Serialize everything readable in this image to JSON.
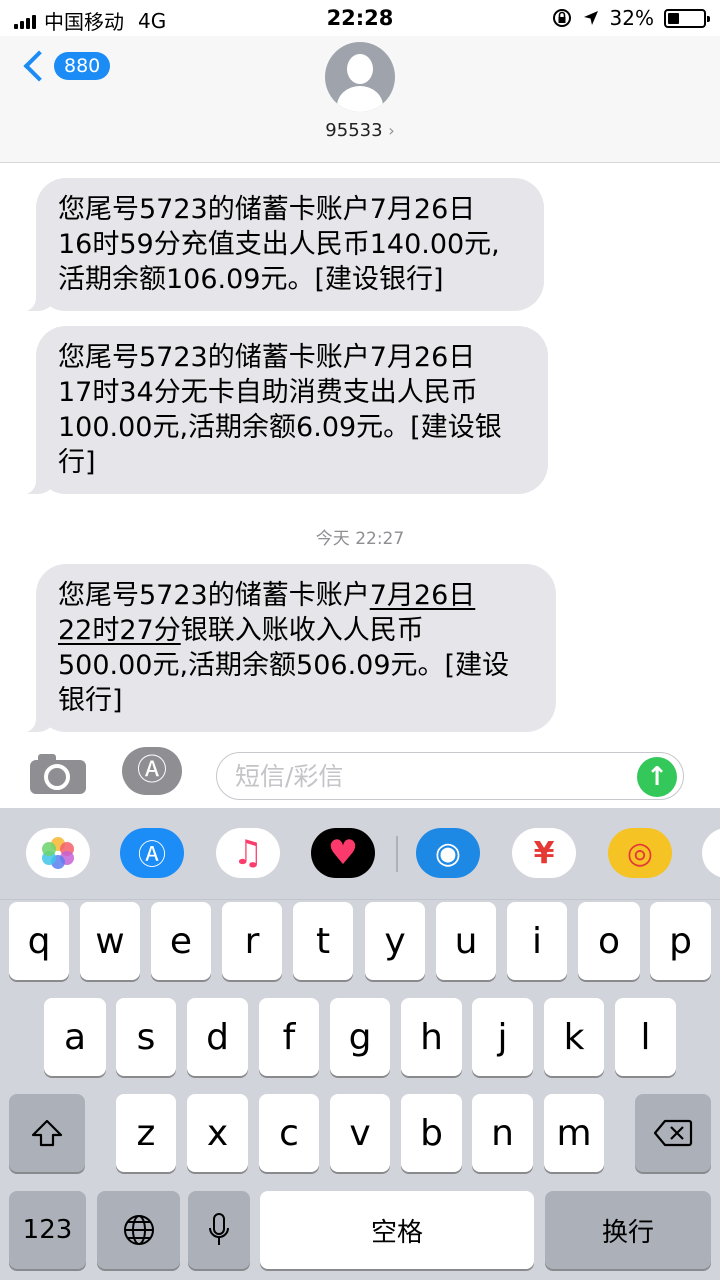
{
  "status_bar": {
    "carrier": "中国移动",
    "network": "4G",
    "time": "22:28",
    "battery_percent": "32%",
    "battery_level": 0.32,
    "icons": [
      "signal-icon",
      "orientation-lock-icon",
      "location-icon",
      "battery-icon"
    ]
  },
  "header": {
    "back_count": "880",
    "contact": "95533"
  },
  "messages": [
    {
      "text": "您尾号5723的储蓄卡账户7月26日16时59分充值支出人民币140.00元,活期余额106.09元。[建设银行]",
      "lines": [
        "您尾号5723的储蓄卡账户7月26日",
        "16时59分充值支出人民币140.00元,",
        "活期余额106.09元。[建设银行]"
      ]
    },
    {
      "text": "您尾号5723的储蓄卡账户7月26日17时34分无卡自助消费支出人民币100.00元,活期余额6.09元。[建设银行]",
      "lines": [
        "您尾号5723的储蓄卡账户7月26日",
        "17时34分无卡自助消费支出人民币",
        "100.00元,活期余额6.09元。[建设银",
        "行]"
      ]
    },
    {
      "text": "您尾号5723的储蓄卡账户7月26日22时27分银联入账收入人民币500.00元,活期余额506.09元。[建设银行]",
      "line1_prefix": "您尾号5723的储蓄卡账户",
      "line1_link": "7月26日",
      "line2_link": "22时27分",
      "line2_rest": "银联入账收入人民币",
      "line3": "500.00元,活期余额506.09元。[建设",
      "line4": "银行]"
    }
  ],
  "timestamp": "今天 22:27",
  "input": {
    "placeholder": "短信/彩信"
  },
  "apps": [
    "photos-app",
    "app-store-app",
    "music-app",
    "heart-sticker-app",
    "dolphin-app",
    "yuan-payment-app",
    "weibo-app",
    "partial-app"
  ],
  "keyboard": {
    "row1": [
      "q",
      "w",
      "e",
      "r",
      "t",
      "y",
      "u",
      "i",
      "o",
      "p"
    ],
    "row2": [
      "a",
      "s",
      "d",
      "f",
      "g",
      "h",
      "j",
      "k",
      "l"
    ],
    "row3": [
      "z",
      "x",
      "c",
      "v",
      "b",
      "n",
      "m"
    ],
    "numbers": "123",
    "space": "空格",
    "return": "换行"
  }
}
